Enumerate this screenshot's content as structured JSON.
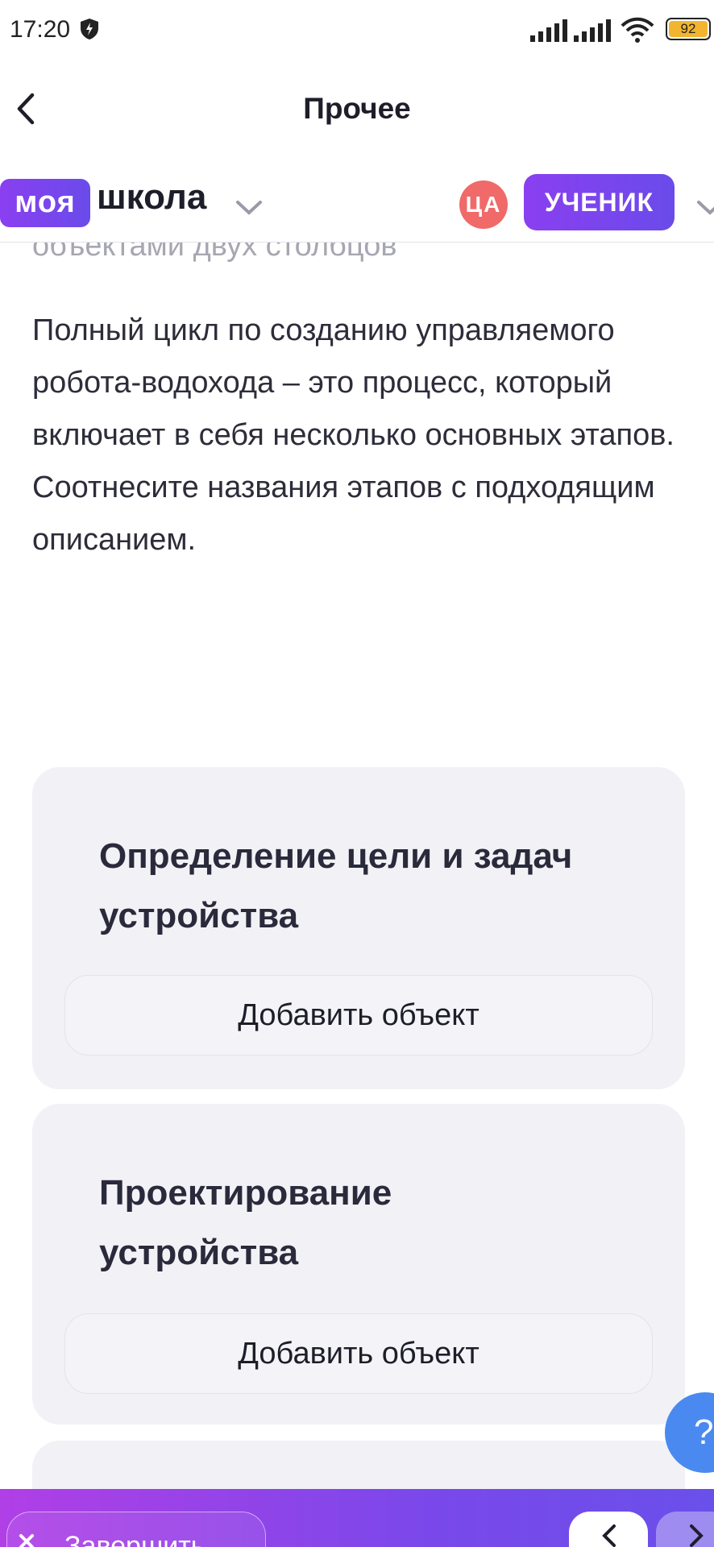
{
  "status_bar": {
    "time": "17:20",
    "battery": "92",
    "icons": [
      "shield-bolt-icon",
      "signal-icon",
      "signal-icon",
      "wifi-icon",
      "battery-icon"
    ]
  },
  "header": {
    "title": "Прочее",
    "back_icon": "chevron-left-icon"
  },
  "school_bar": {
    "logo_part1": "моя",
    "logo_part2": "школа",
    "avatar_initials": "ЦА",
    "role": "УЧЕНИК",
    "accent": "#7a44ee",
    "avatar_color": "#f06a6a"
  },
  "content": {
    "faded_text": "объектами двух столбцов",
    "question": "Полный цикл по созданию управляемого робота-водохода – это процесс, который включает в себя несколько основных этапов. Соотнесите названия этапов с подходящим описанием.",
    "cards": [
      {
        "title": "Определение цели и задач устройства",
        "button": "Добавить объект"
      },
      {
        "title": "Проектирование устройства",
        "button": "Добавить объект"
      }
    ]
  },
  "help": {
    "label": "?"
  },
  "bottom_bar": {
    "finish_label": "Завершить",
    "gradient_start": "#b03fe6",
    "gradient_end": "#6a50ea"
  }
}
